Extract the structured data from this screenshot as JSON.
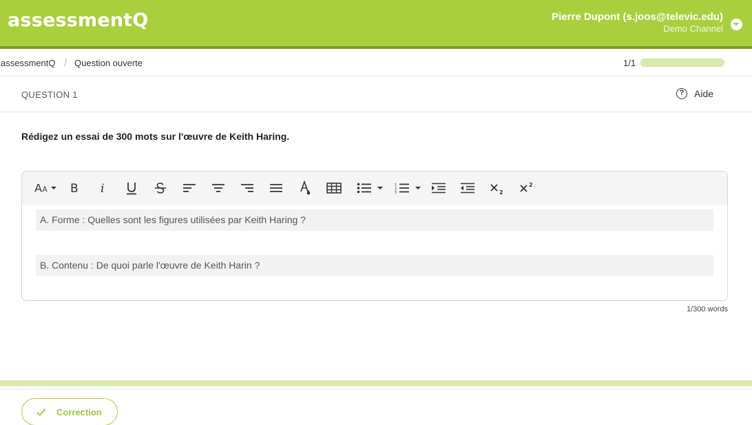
{
  "header": {
    "logo": "assessmentQ",
    "user_name": "Pierre Dupont (s.joos@televic.edu)",
    "channel": "Demo Channel",
    "menu_icon": "chevron-down-icon"
  },
  "breadcrumb": {
    "root": "assessmentQ",
    "separator": "/",
    "current": "Question ouverte"
  },
  "progress": {
    "text": "1/1",
    "fraction": 1.0
  },
  "question": {
    "label": "QUESTION 1",
    "help_label": "Aide",
    "help_icon": "help-circle-icon",
    "prompt": "Rédigez un essai de 300 mots sur l'œuvre de Keith Haring."
  },
  "editor": {
    "toolbar_icons": [
      "font-size-icon",
      "bold-icon",
      "italic-icon",
      "underline-icon",
      "strikethrough-icon",
      "align-left-icon",
      "align-center-icon",
      "align-right-icon",
      "align-justify-icon",
      "text-color-icon",
      "table-icon",
      "bullet-list-icon",
      "numbered-list-icon",
      "indent-icon",
      "outdent-icon",
      "subscript-icon",
      "superscript-icon"
    ],
    "paragraphs": [
      "A. Forme : Quelles sont les figures utilisées par Keith Haring ?",
      "B. Contenu : De quoi parle l'œuvre de Keith Harin ?"
    ],
    "word_count": "1/300 words"
  },
  "footer": {
    "correction_label": "Correction",
    "correction_icon": "check-icon"
  },
  "colors": {
    "brand": "#a8cf3c",
    "brand_dark": "#7e9a2d",
    "brand_light": "#d7ebb0"
  }
}
